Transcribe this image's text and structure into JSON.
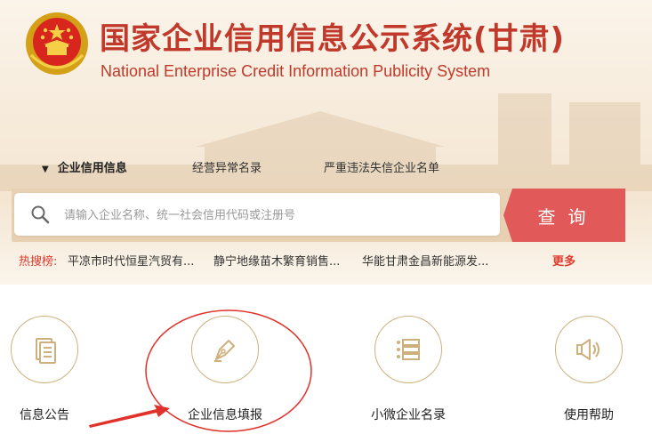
{
  "header": {
    "title_cn": "国家企业信用信息公示系统(甘肃)",
    "title_en": "National Enterprise Credit Information Publicity System"
  },
  "tabs": [
    {
      "label": "企业信用信息",
      "active": true
    },
    {
      "label": "经营异常名录",
      "active": false
    },
    {
      "label": "严重违法失信企业名单",
      "active": false
    }
  ],
  "search": {
    "placeholder": "请输入企业名称、统一社会信用代码或注册号",
    "value": "",
    "button_label": "查询"
  },
  "hot": {
    "label": "热搜榜:",
    "items": [
      "平凉市时代恒星汽贸有...",
      "静宁地缘苗木繁育销售...",
      "华能甘肃金昌新能源发..."
    ],
    "more_label": "更多"
  },
  "functions": [
    {
      "label": "信息公告",
      "icon": "document-icon"
    },
    {
      "label": "企业信息填报",
      "icon": "pen-nib-icon"
    },
    {
      "label": "小微企业名录",
      "icon": "list-icon"
    },
    {
      "label": "使用帮助",
      "icon": "speaker-icon"
    }
  ],
  "colors": {
    "brand_red": "#c0392b",
    "search_button": "#e2595a",
    "hot_label": "#e03b2e",
    "icon_gold": "#cdb07c",
    "annotation_red": "#e0322a"
  }
}
